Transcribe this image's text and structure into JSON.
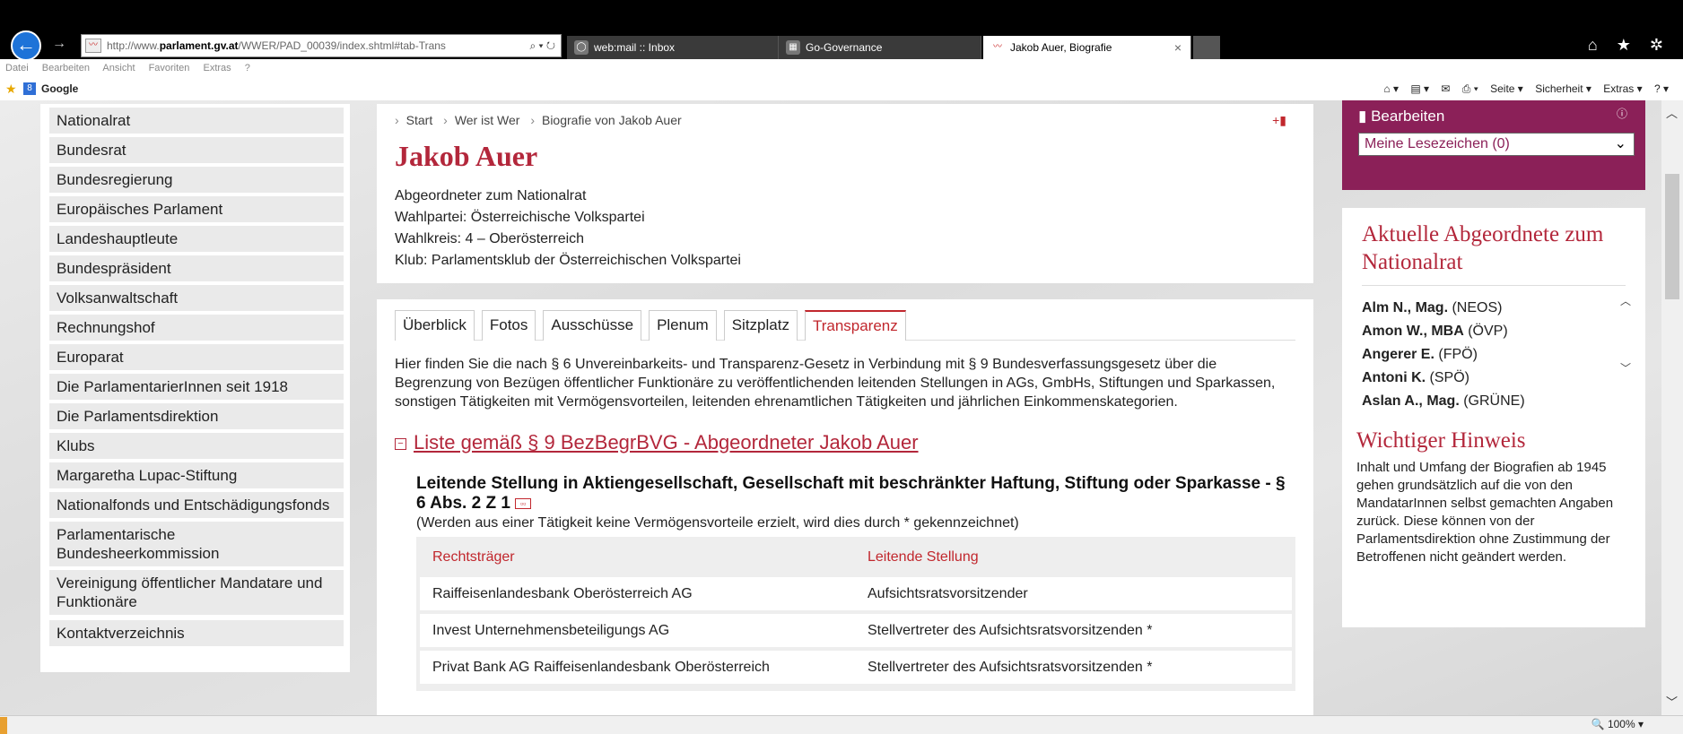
{
  "browser": {
    "back_icon": "back-arrow-icon",
    "forward_icon": "forward-arrow-icon",
    "address_prefix": "http://www.",
    "address_domain": "parlament.gv.at",
    "address_path": "/WWER/PAD_00039/index.shtml#tab-Trans",
    "address_controls": "⌕ ▾ ↻",
    "tabs": [
      {
        "label": "web:mail :: Inbox"
      },
      {
        "label": "Go-Governance"
      },
      {
        "label": "Jakob Auer, Biografie",
        "close": "×"
      }
    ],
    "right_icons": "⌂ ★ ✲"
  },
  "menu": [
    "Datei",
    "Bearbeiten",
    "Ansicht",
    "Favoriten",
    "Extras",
    "?"
  ],
  "favbar": {
    "google": "Google",
    "g_badge": "8",
    "home": "⌂ ▾",
    "feed": "▤ ▾",
    "mail": "✉",
    "print": "⎙ ▾",
    "seite": "Seite ▾",
    "sicherheit": "Sicherheit ▾",
    "extras": "Extras ▾",
    "help": "? ▾"
  },
  "leftnav": [
    "Nationalrat",
    "Bundesrat",
    "Bundesregierung",
    "Europäisches Parlament",
    "Landeshauptleute",
    "Bundespräsident",
    "Volksanwaltschaft",
    "Rechnungshof",
    "Europarat",
    "Die ParlamentarierInnen seit 1918",
    "Die Parlamentsdirektion",
    "Klubs",
    "Margaretha Lupac-Stiftung",
    "Nationalfonds und Entschädigungsfonds",
    "Parlamentarische Bundesheerkommission",
    "Vereinigung öffentlicher Mandatare und Funktionäre",
    "Kontaktverzeichnis"
  ],
  "breadcrumb": [
    "Start",
    "Wer ist Wer",
    "Biografie von Jakob Auer"
  ],
  "person": {
    "name": "Jakob Auer",
    "role": "Abgeordneter zum Nationalrat",
    "wahlpartei": "Wahlpartei: Österreichische Volkspartei",
    "wahlkreis": "Wahlkreis: 4 – Oberösterreich",
    "klub": "Klub: Parlamentsklub der Österreichischen Volkspartei"
  },
  "tabs": [
    "Überblick",
    "Fotos",
    "Ausschüsse",
    "Plenum",
    "Sitzplatz",
    "Transparenz"
  ],
  "intro": "Hier finden Sie die nach § 6 Unvereinbarkeits- und Transparenz-Gesetz in Verbindung mit § 9 Bundesverfassungsgesetz über die Begrenzung von Bezügen öffentlicher Funktionäre zu veröffentlichenden leitenden Stellungen in AGs, GmbHs, Stiftungen und Sparkassen, sonstigen Tätigkeiten mit Vermögensvorteilen, leitenden ehrenamtlichen Tätigkeiten und jährlichen Einkommenskategorien.",
  "list_link": "Liste gemäß § 9 BezBegrBVG - Abgeordneter Jakob Auer",
  "list_toggle": "−",
  "section": {
    "title": "Leitende Stellung in Aktiengesellschaft, Gesellschaft mit beschränkter Haftung, Stiftung oder Sparkasse - § 6 Abs. 2 Z 1",
    "note": "(Werden aus einer Tätigkeit keine Vermögensvorteile erzielt, wird dies durch * gekennzeichnet)",
    "columns": [
      "Rechtsträger",
      "Leitende Stellung"
    ],
    "rows": [
      [
        "Raiffeisenlandesbank Oberösterreich AG",
        "Aufsichtsratsvorsitzender"
      ],
      [
        "Invest Unternehmensbeteiligungs AG",
        "Stellvertreter des Aufsichtsratsvorsitzenden *"
      ],
      [
        "Privat Bank AG Raiffeisenlandesbank Oberösterreich",
        "Stellvertreter des Aufsichtsratsvorsitzenden *"
      ]
    ]
  },
  "bookmarks": {
    "edit": "Bearbeiten",
    "select": "Meine Lesezeichen (0)"
  },
  "aktuelle": {
    "title": "Aktuelle Abgeordnete zum Nationalrat",
    "items": [
      {
        "name": "Alm N., Mag.",
        "party": "(NEOS)"
      },
      {
        "name": "Amon W., MBA",
        "party": "(ÖVP)"
      },
      {
        "name": "Angerer E.",
        "party": "(FPÖ)"
      },
      {
        "name": "Antoni K.",
        "party": "(SPÖ)"
      },
      {
        "name": "Aslan A., Mag.",
        "party": "(GRÜNE)"
      }
    ]
  },
  "hinweis": {
    "title": "Wichtiger Hinweis",
    "text": "Inhalt und Umfang der Biografien ab 1945 gehen grundsätzlich auf die von den MandatarInnen selbst gemachten Angaben zurück. Diese können von der Parlamentsdirektion ohne Zustimmung der Betroffenen nicht geändert werden."
  },
  "status": {
    "zoom": "100%"
  },
  "colors": {
    "accent": "#b3273b",
    "bookmark_bg": "#8b2058"
  }
}
